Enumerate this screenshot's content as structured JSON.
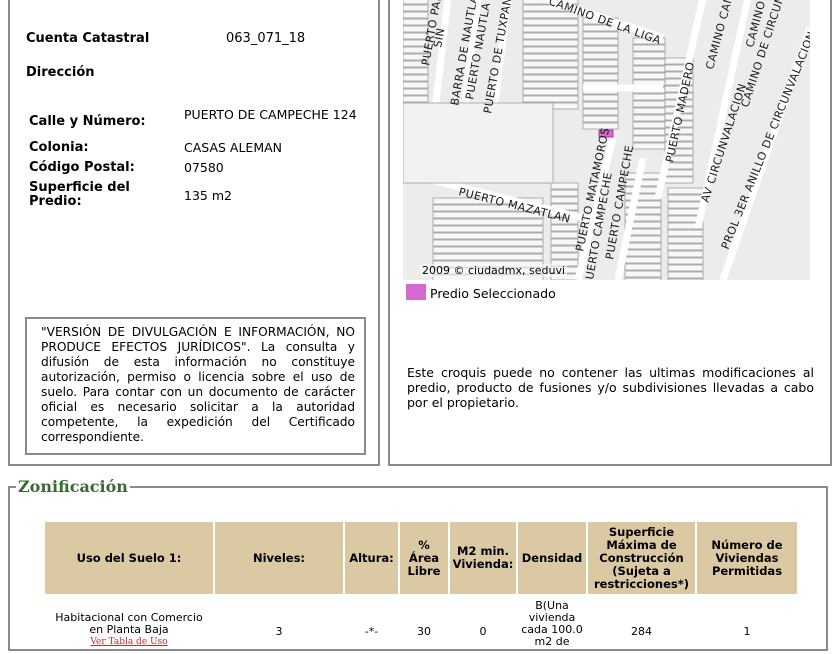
{
  "predio": {
    "cuenta_label": "Cuenta Catastral",
    "cuenta_value": "063_071_18",
    "direccion_label": "Dirección",
    "calle_label": "Calle y Número:",
    "calle_value": "PUERTO DE CAMPECHE 124",
    "colonia_label": "Colonia:",
    "colonia_value": "CASAS ALEMAN",
    "cp_label": "Código Postal:",
    "cp_value": "07580",
    "superficie_label": "Superficie del Predio:",
    "superficie_value": "135 m2"
  },
  "disclaimer": "\"VERSIÓN DE DIVULGACIÓN E INFORMACIÓN, NO PRODUCE EFECTOS JURÍDICOS\". La consulta y difusión de esta información no constituye autorización, permiso o licencia sobre el uso de suelo. Para contar con un documento de carácter oficial es necesario solicitar a la autoridad competente, la expedición del Certificado correspondiente.",
  "map": {
    "streets": [
      "PUERTO PAPAN",
      "SIN",
      "BARRA DE NAUTLA",
      "PUERTO NAUTLA",
      "PUERTO DE TUXPAN",
      "CAMINO DE LA LIGA",
      "CAMINO CAMPE",
      "CAMINO DE LA AN",
      "CAMINO DE CIRCUNVALACION",
      "PUERTO MADERO",
      "AV CIRCUNVALACION",
      "PROL 3ER ANILLO DE CIRCUNVALACION",
      "PUERTO MAZATLAN",
      "PUERTO MATAMOROS",
      "PUERTO CAMPECHE",
      "UERTO CAMPECHE"
    ],
    "copyright": "2009 © ciudadmx, seduvi",
    "legend_label": "Predio Seleccionado",
    "highlight_color": "#d36ad0",
    "note": "Este croquis puede no contener las ultimas modificaciones al predio, producto de fusiones y/o subdivisiones llevadas a cabo por el propietario."
  },
  "zonificacion": {
    "title": "Zonificación",
    "headers": [
      "Uso del Suelo 1:",
      "Niveles:",
      "Altura:",
      "% Área Libre",
      "M2 min. Vivienda:",
      "Densidad",
      "Superficie Máxima de Construcción (Sujeta a restricciones*)",
      "Número de Viviendas Permitidas"
    ],
    "row": {
      "uso": "Habitacional con Comercio en Planta Baja",
      "uso_link": "Ver Tabla de Uso",
      "niveles": "3",
      "altura": "-*-",
      "area_libre": "30",
      "m2_min": "0",
      "densidad": "B(Una vivienda cada 100.0 m2 de",
      "superficie": "284",
      "viviendas": "1"
    },
    "header_color": "#dbc9a4",
    "title_color": "#3a6b35"
  }
}
